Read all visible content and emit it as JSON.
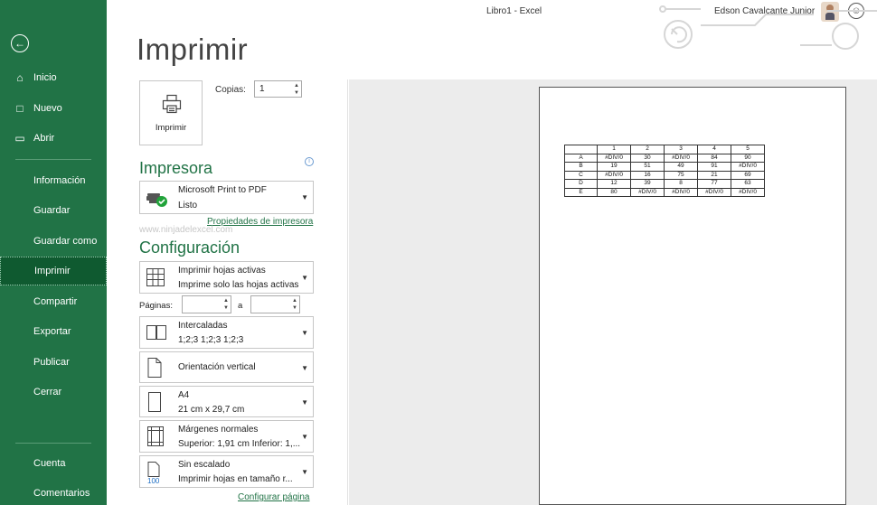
{
  "window": {
    "title": "Libro1  -  Excel",
    "user": "Edson Cavalcante Junior"
  },
  "sidebar": {
    "items": [
      {
        "label": "Inicio",
        "icon": "home-icon"
      },
      {
        "label": "Nuevo",
        "icon": "new-file-icon"
      },
      {
        "label": "Abrir",
        "icon": "folder-icon"
      },
      {
        "label": "Información"
      },
      {
        "label": "Guardar"
      },
      {
        "label": "Guardar como"
      },
      {
        "label": "Imprimir",
        "selected": true
      },
      {
        "label": "Compartir"
      },
      {
        "label": "Exportar"
      },
      {
        "label": "Publicar"
      },
      {
        "label": "Cerrar"
      },
      {
        "label": "Cuenta"
      },
      {
        "label": "Comentarios"
      }
    ]
  },
  "page": {
    "title": "Imprimir"
  },
  "print": {
    "button_label": "Imprimir",
    "copies_label": "Copias:",
    "copies_value": "1"
  },
  "printer": {
    "section_title": "Impresora",
    "name": "Microsoft Print to PDF",
    "status": "Listo",
    "properties_link": "Propiedades de impresora"
  },
  "watermark": "www.ninjadelexcel.com",
  "settings": {
    "section_title": "Configuración",
    "what": {
      "line1": "Imprimir hojas activas",
      "line2": "Imprime solo las hojas activas"
    },
    "pages_label": "Páginas:",
    "pages_to": "a",
    "collate": {
      "line1": "Intercaladas",
      "line2": "1;2;3    1;2;3    1;2;3"
    },
    "orientation": {
      "line1": "Orientación vertical"
    },
    "paper": {
      "line1": "A4",
      "line2": "21 cm x 29,7 cm"
    },
    "margins": {
      "line1": "Márgenes normales",
      "line2": "Superior: 1,91 cm Inferior: 1,..."
    },
    "scaling": {
      "line1": "Sin escalado",
      "line2": "Imprimir hojas en tamaño r..."
    },
    "page_setup_link": "Configurar página"
  },
  "preview": {
    "header": [
      "",
      "1",
      "2",
      "3",
      "4",
      "5"
    ],
    "rows": [
      [
        "A",
        "#DIV/0",
        "30",
        "#DIV/0",
        "84",
        "90"
      ],
      [
        "B",
        "19",
        "51",
        "49",
        "91",
        "#DIV/0"
      ],
      [
        "C",
        "#DIV/0",
        "16",
        "75",
        "21",
        "69"
      ],
      [
        "D",
        "12",
        "39",
        "8",
        "77",
        "63"
      ],
      [
        "E",
        "80",
        "#DIV/0",
        "#DIV/0",
        "#DIV/0",
        "#DIV/0"
      ]
    ]
  },
  "colors": {
    "accent": "#217346",
    "sidebar_selected": "#0f5a30"
  }
}
